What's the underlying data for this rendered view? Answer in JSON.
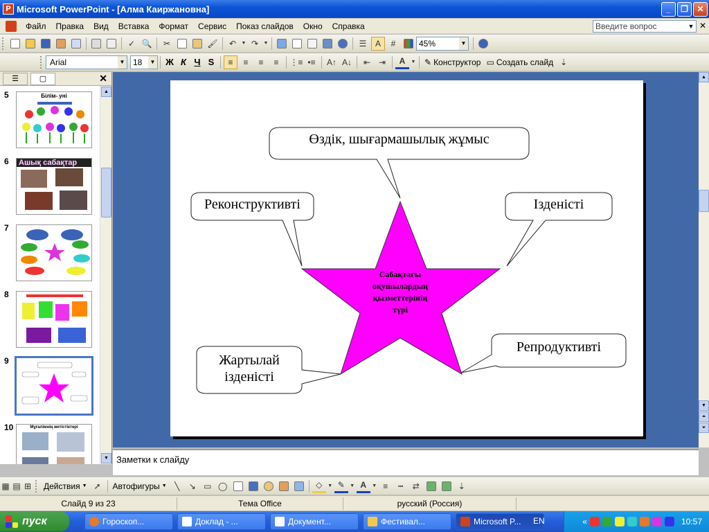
{
  "window": {
    "title": "Microsoft PowerPoint - [Алма Каиржановна]",
    "app_icon": "P"
  },
  "menu": {
    "items": [
      "Файл",
      "Правка",
      "Вид",
      "Вставка",
      "Формат",
      "Сервис",
      "Показ слайдов",
      "Окно",
      "Справка"
    ],
    "help_placeholder": "Введите вопрос"
  },
  "toolbar": {
    "zoom": "45%"
  },
  "format": {
    "font": "Arial",
    "size": "18",
    "bold": "Ж",
    "italic": "К",
    "underline": "Ч",
    "shadow": "S",
    "designer": "Конструктор",
    "new_slide": "Создать слайд"
  },
  "thumbnails": [
    {
      "num": "5",
      "title": "Білім- уні"
    },
    {
      "num": "6",
      "title": "Ашық сабақтар"
    },
    {
      "num": "7",
      "title": ""
    },
    {
      "num": "8",
      "title": ""
    },
    {
      "num": "9",
      "title": ""
    },
    {
      "num": "10",
      "title": "Мұғалімнің жетістіктері"
    }
  ],
  "slide": {
    "center_lines": [
      "Сабақтағы",
      "оқушылардың",
      "қызметтерінің",
      "түрі"
    ],
    "callouts": {
      "top": "Өздік, шығармашылық жұмыс",
      "left": "Реконструктивті",
      "right": "Ізденісті",
      "bottom_left_1": "Жартылай",
      "bottom_left_2": "ізденісті",
      "bottom_right": "Репродуктивті"
    },
    "star_color": "#ff00ff"
  },
  "notes": {
    "placeholder": "Заметки к слайду"
  },
  "drawing": {
    "actions": "Действия",
    "autoshapes": "Автофигуры"
  },
  "status": {
    "slide": "Слайд 9 из 23",
    "theme": "Тема Office",
    "language": "русский (Россия)"
  },
  "taskbar": {
    "start": "пуск",
    "tasks": [
      "Гороскоп...",
      "Доклад - ...",
      "Документ...",
      "Фестивал...",
      "Microsoft P..."
    ],
    "lang": "EN",
    "time": "10:57"
  }
}
